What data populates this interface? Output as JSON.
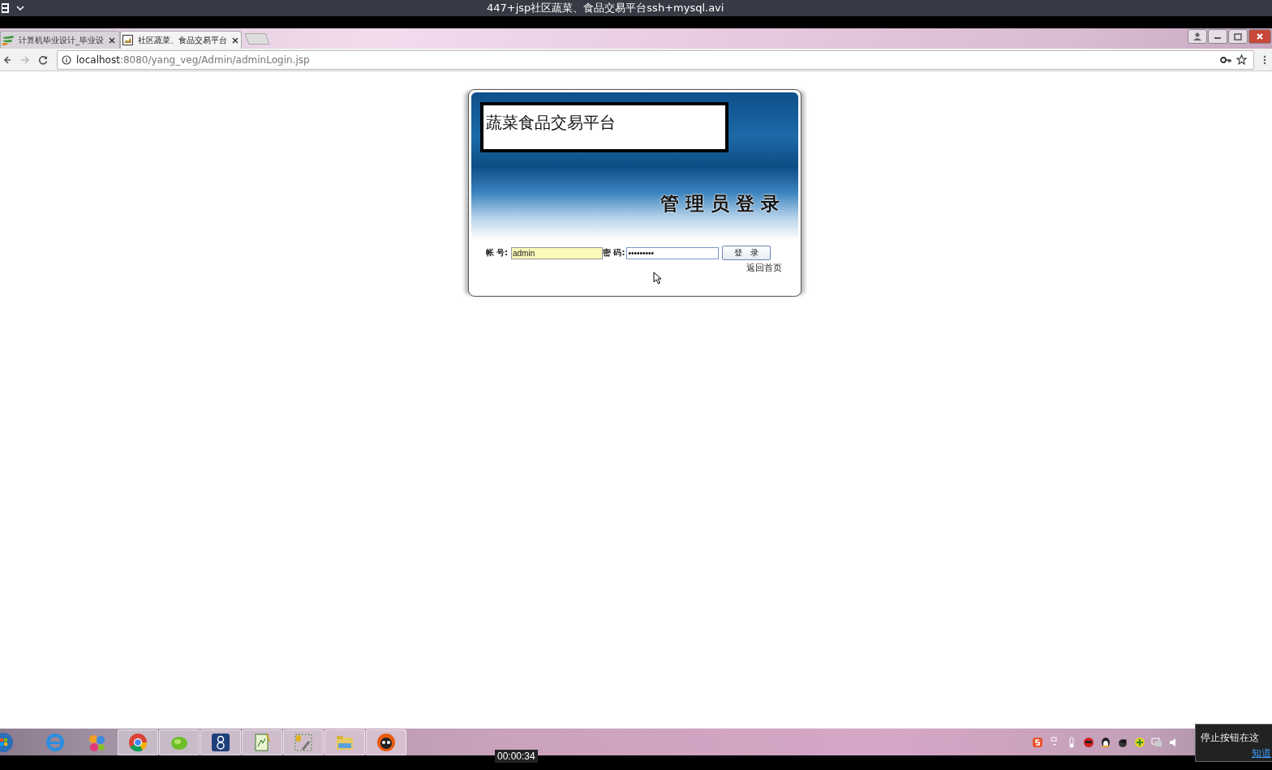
{
  "player": {
    "title": "447+jsp社区蔬菜、食品交易平台ssh+mysql.avi",
    "time": "00:00:34"
  },
  "browser": {
    "tabs": [
      {
        "title": "计算机毕业设计_毕业设",
        "selected": false
      },
      {
        "title": "社区蔬菜、食品交易平台",
        "selected": true
      }
    ],
    "url_host": "localhost",
    "url_path": ":8080/yang_veg/Admin/adminLogin.jsp"
  },
  "login": {
    "site_title": "蔬菜食品交易平台",
    "heading": "管 理 员 登 录",
    "account_label": "帐 号:",
    "account_value": "admin",
    "password_label": "密 码:",
    "password_value": "•••••••••",
    "submit": "登　录",
    "home_link": "返回首页"
  },
  "notification": {
    "text": "停止按钮在这",
    "link": "知道"
  }
}
